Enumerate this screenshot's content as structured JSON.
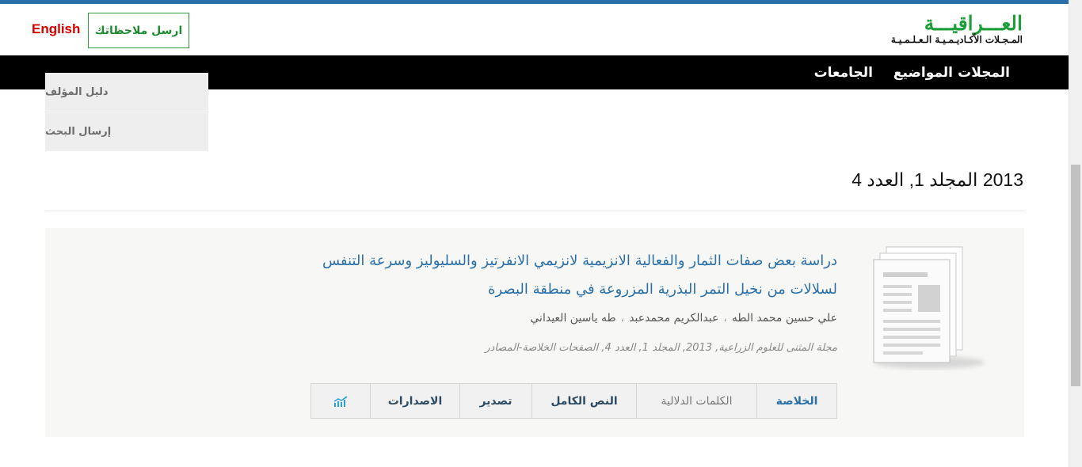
{
  "header": {
    "language_button": "English",
    "feedback_button": "ارسل ملاحظاتك",
    "logo_title": "العـــراقيـــة",
    "logo_subtitle": "المـجـلات الأكـاديـمـيـة الـعـلـمـيـة"
  },
  "nav": {
    "items": [
      "المجلات",
      "المواضيع",
      "الجامعات"
    ]
  },
  "side_menu": {
    "items": [
      "دليل المؤلف",
      "إرسال البحث"
    ]
  },
  "issue": {
    "title": "2013 المجلد 1, العدد 4"
  },
  "article": {
    "title": "دراسة بعض صفات الثمار والفعالية الانزيمية لانزيمي الانفرتيز والسليوليز وسرعة التنفس لسلالات من نخيل التمر البذرية المزروعة في منطقة البصرة",
    "authors": [
      "علي حسين محمد الطه",
      "عبدالكريم محمدعبد",
      "طه ياسين العيداني"
    ],
    "author_separator": "،",
    "citation": "مجلة المثنى للعلوم الزراعية, 2013, المجلد 1, العدد 4, الصفحات الخلاصة-المصادر",
    "tabs": {
      "abstract": "الخلاصة",
      "keywords": "الكلمات الدلالية",
      "fulltext": "النص الكامل",
      "export": "تصدير",
      "versions": "الاصدارات",
      "stats_icon": "stats-chart-icon"
    }
  },
  "colors": {
    "brand_green": "#1d9e3b",
    "link_blue": "#2a6fa8",
    "english_red": "#d40000",
    "nav_bg": "#000000"
  }
}
